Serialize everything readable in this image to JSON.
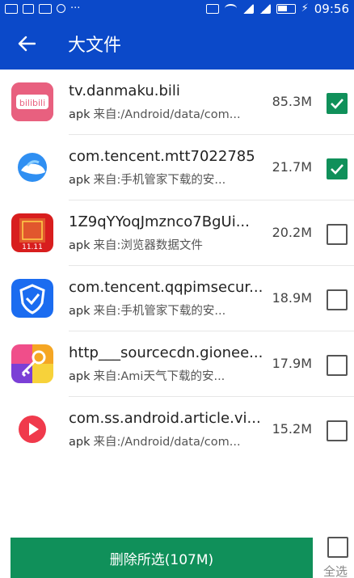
{
  "status_bar": {
    "time": "09:56"
  },
  "header": {
    "title": "大文件"
  },
  "files": [
    {
      "name": "tv.danmaku.bili",
      "ext": "apk",
      "source": "来自:/Android/data/com...",
      "size": "85.3M",
      "checked": true,
      "icon": "bilibili-app-icon"
    },
    {
      "name": "com.tencent.mtt7022785",
      "ext": "apk",
      "source": "来自:手机管家下载的安...",
      "size": "21.7M",
      "checked": true,
      "icon": "qq-browser-app-icon"
    },
    {
      "name": "1Z9qYYoqJmznco7BgUi...",
      "ext": "apk",
      "source": "来自:浏览器数据文件",
      "size": "20.2M",
      "checked": false,
      "icon": "tmall-1111-app-icon"
    },
    {
      "name": "com.tencent.qqpimsecur...",
      "ext": "apk",
      "source": "来自:手机管家下载的安...",
      "size": "18.9M",
      "checked": false,
      "icon": "tencent-security-app-icon"
    },
    {
      "name": "http___sourcecdn.gionee...",
      "ext": "apk",
      "source": "来自:Ami天气下载的安...",
      "size": "17.9M",
      "checked": false,
      "icon": "key-app-icon"
    },
    {
      "name": "com.ss.android.article.vi...",
      "ext": "apk",
      "source": "来自:/Android/data/com...",
      "size": "15.2M",
      "checked": false,
      "icon": "xigua-video-app-icon"
    }
  ],
  "footer": {
    "delete_label": "删除所选(107M)",
    "select_all_label": "全选"
  },
  "colors": {
    "header_bg": "#0b49c9",
    "accent_green": "#10905a"
  }
}
